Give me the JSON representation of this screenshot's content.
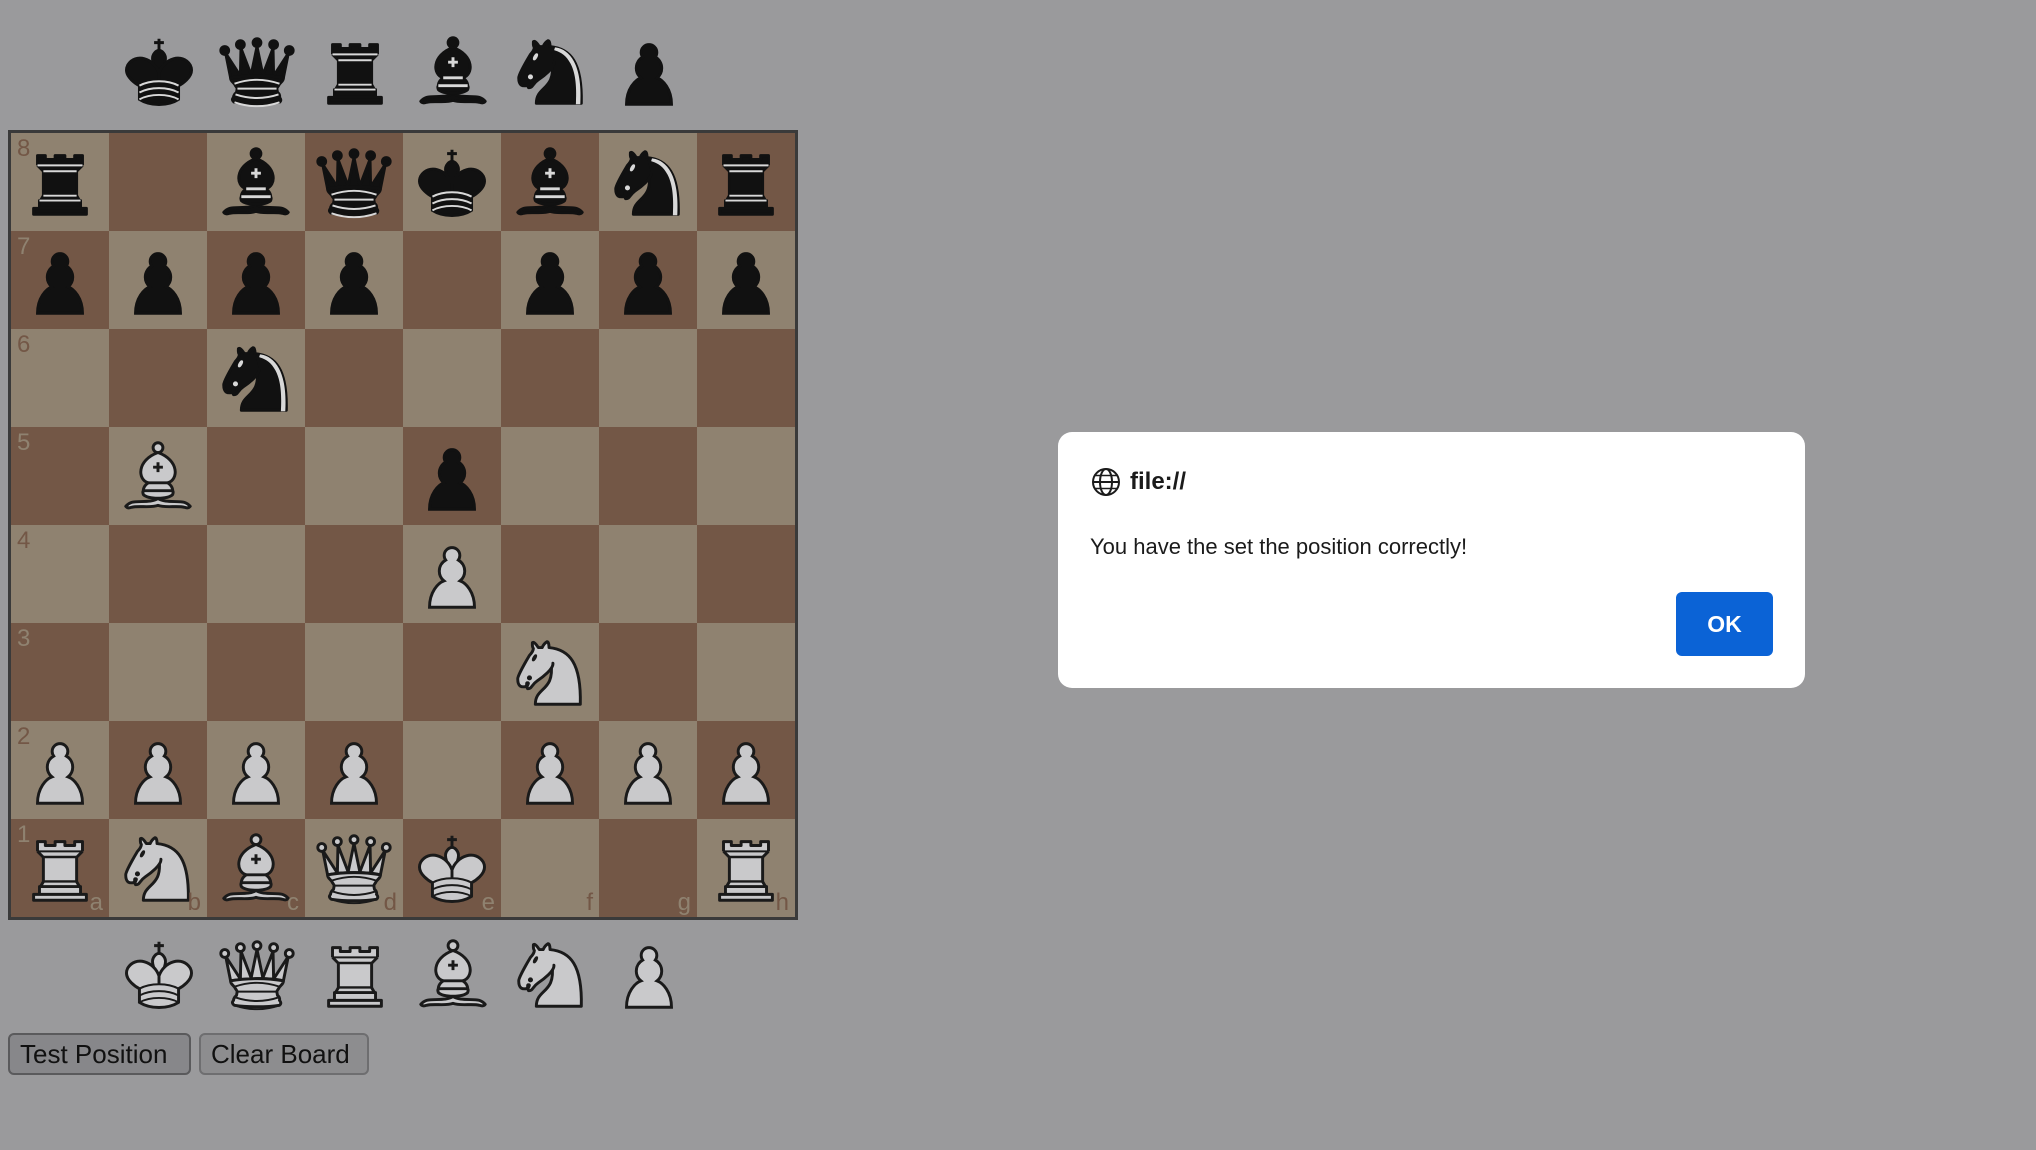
{
  "spare_pieces": {
    "black": [
      "king",
      "queen",
      "rook",
      "bishop",
      "knight",
      "pawn"
    ],
    "white": [
      "king",
      "queen",
      "rook",
      "bishop",
      "knight",
      "pawn"
    ]
  },
  "board": {
    "light_color": "#8f8270",
    "dark_color": "#735746",
    "ranks": [
      "8",
      "7",
      "6",
      "5",
      "4",
      "3",
      "2",
      "1"
    ],
    "files": [
      "a",
      "b",
      "c",
      "d",
      "e",
      "f",
      "g",
      "h"
    ],
    "position": [
      [
        "bR",
        "",
        "bB",
        "bQ",
        "bK",
        "bB",
        "bN",
        "bR"
      ],
      [
        "bP",
        "bP",
        "bP",
        "bP",
        "",
        "bP",
        "bP",
        "bP"
      ],
      [
        "",
        "",
        "bN",
        "",
        "",
        "",
        "",
        ""
      ],
      [
        "",
        "wB",
        "",
        "",
        "bP",
        "",
        "",
        ""
      ],
      [
        "",
        "",
        "",
        "",
        "wP",
        "",
        "",
        ""
      ],
      [
        "",
        "",
        "",
        "",
        "",
        "wN",
        "",
        ""
      ],
      [
        "wP",
        "wP",
        "wP",
        "wP",
        "",
        "wP",
        "wP",
        "wP"
      ],
      [
        "wR",
        "wN",
        "wB",
        "wQ",
        "wK",
        "",
        "",
        "wR"
      ]
    ]
  },
  "buttons": {
    "test_label": "Test Position",
    "clear_label": "Clear Board"
  },
  "dialog": {
    "origin": "file://",
    "message": "You have the set the position correctly!",
    "ok_label": "OK",
    "ok_color": "#0b63d6"
  }
}
